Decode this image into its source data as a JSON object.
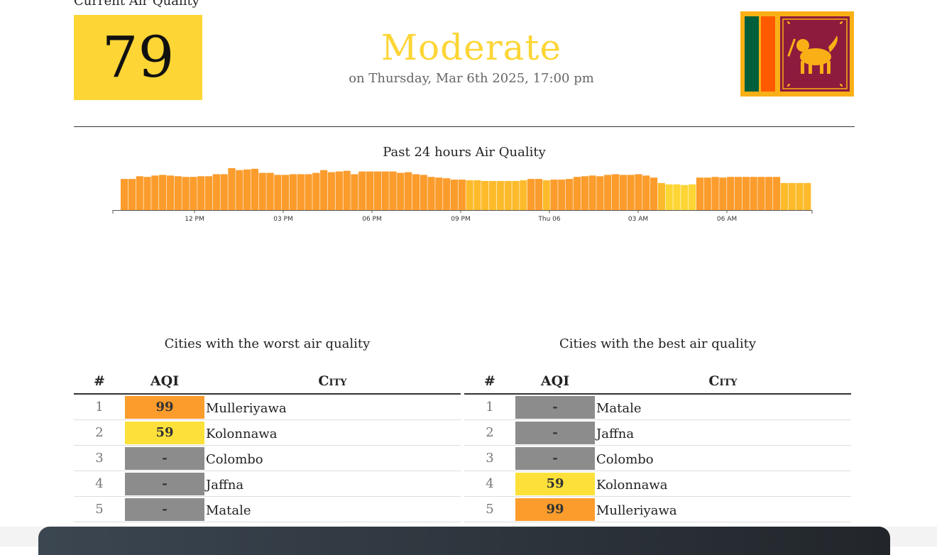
{
  "current": {
    "label": "Current Air Quality",
    "aqi": "79",
    "level": "Moderate",
    "date": "on Thursday, Mar 6th 2025, 17:00 pm",
    "aqi_color": "#fdd535"
  },
  "flag": {
    "icon": "sri-lanka-flag-icon"
  },
  "chart_data": {
    "type": "bar",
    "title": "Past 24 hours Air Quality",
    "xlabel": "",
    "ylabel": "",
    "tick_labels": [
      "12 PM",
      "03 PM",
      "06 PM",
      "09 PM",
      "Thu 06",
      "03 AM",
      "06 AM"
    ],
    "values": [
      46,
      46,
      50,
      49,
      51,
      52,
      51,
      50,
      49,
      49,
      50,
      50,
      53,
      53,
      62,
      59,
      60,
      61,
      55,
      55,
      52,
      52,
      53,
      53,
      53,
      55,
      59,
      56,
      57,
      58,
      53,
      57,
      57,
      57,
      57,
      57,
      55,
      56,
      53,
      52,
      49,
      48,
      47,
      45,
      45,
      44,
      44,
      43,
      43,
      43,
      43,
      43,
      44,
      46,
      46,
      44,
      45,
      45,
      46,
      49,
      50,
      51,
      50,
      52,
      53,
      52,
      52,
      53,
      51,
      48,
      40,
      38,
      38,
      37,
      38,
      48,
      48,
      49,
      48,
      49,
      49,
      49,
      49,
      49,
      49,
      49,
      40,
      40,
      40,
      40
    ],
    "colors": {
      "moderate_high": "#fb9c2c",
      "moderate": "#fdbb2c",
      "good": "#fdd535"
    }
  },
  "worst": {
    "title": "Cities with the worst air quality",
    "headers": [
      "#",
      "AQI",
      "City"
    ],
    "rows": [
      {
        "rank": "1",
        "aqi": "99",
        "city": "Mulleriyawa",
        "color": "#fb9c2c"
      },
      {
        "rank": "2",
        "aqi": "59",
        "city": "Kolonnawa",
        "color": "#fde13a"
      },
      {
        "rank": "3",
        "aqi": "-",
        "city": "Colombo",
        "color": "#8c8c8c"
      },
      {
        "rank": "4",
        "aqi": "-",
        "city": "Jaffna",
        "color": "#8c8c8c"
      },
      {
        "rank": "5",
        "aqi": "-",
        "city": "Matale",
        "color": "#8c8c8c"
      }
    ]
  },
  "best": {
    "title": "Cities with the best air quality",
    "headers": [
      "#",
      "AQI",
      "City"
    ],
    "rows": [
      {
        "rank": "1",
        "aqi": "-",
        "city": "Matale",
        "color": "#8c8c8c"
      },
      {
        "rank": "2",
        "aqi": "-",
        "city": "Jaffna",
        "color": "#8c8c8c"
      },
      {
        "rank": "3",
        "aqi": "-",
        "city": "Colombo",
        "color": "#8c8c8c"
      },
      {
        "rank": "4",
        "aqi": "59",
        "city": "Kolonnawa",
        "color": "#fde13a"
      },
      {
        "rank": "5",
        "aqi": "99",
        "city": "Mulleriyawa",
        "color": "#fb9c2c"
      }
    ]
  }
}
